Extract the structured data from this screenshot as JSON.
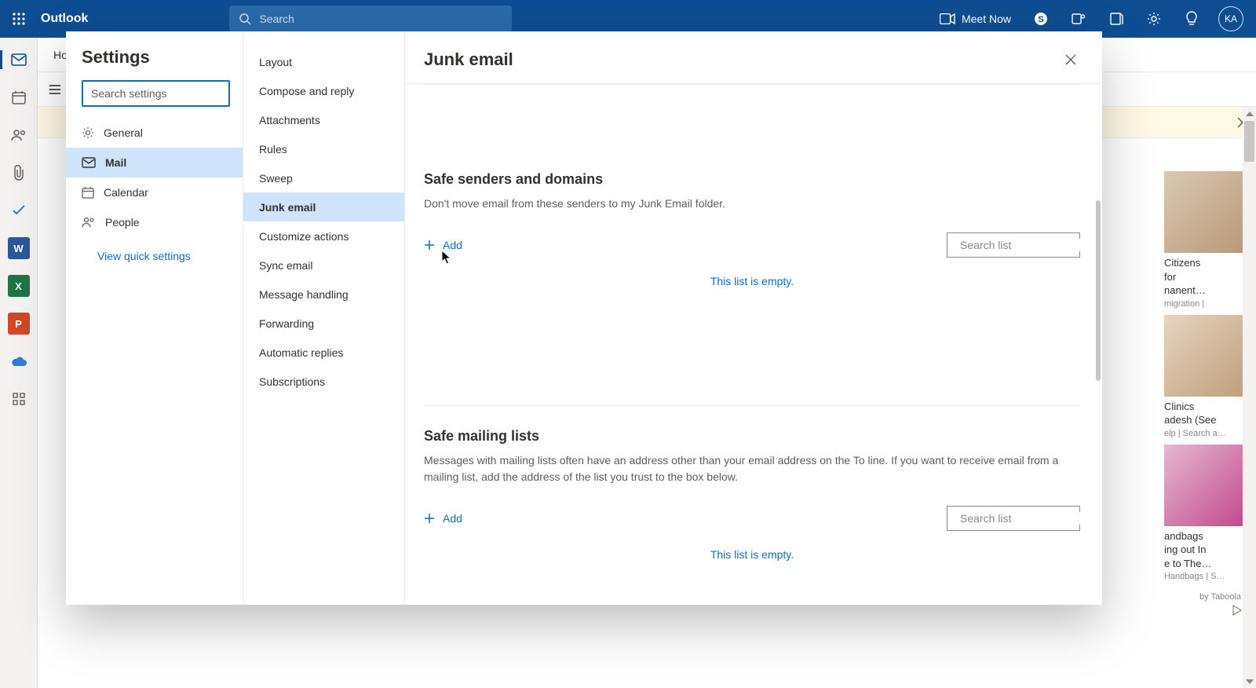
{
  "header": {
    "brand": "Outlook",
    "search_placeholder": "Search",
    "meet_now": "Meet Now",
    "avatar_initials": "KA"
  },
  "behind": {
    "home_label": "Ho"
  },
  "modal": {
    "title": "Settings",
    "search_placeholder": "Search settings",
    "nav1": {
      "general": "General",
      "mail": "Mail",
      "calendar": "Calendar",
      "people": "People"
    },
    "quick_settings": "View quick settings",
    "nav2": {
      "layout": "Layout",
      "compose": "Compose and reply",
      "attachments": "Attachments",
      "rules": "Rules",
      "sweep": "Sweep",
      "junk": "Junk email",
      "customize": "Customize actions",
      "sync": "Sync email",
      "message_handling": "Message handling",
      "forwarding": "Forwarding",
      "automatic_replies": "Automatic replies",
      "subscriptions": "Subscriptions"
    },
    "page": {
      "title": "Junk email",
      "safe_senders": {
        "heading": "Safe senders and domains",
        "desc": "Don't move email from these senders to my Junk Email folder.",
        "add": "Add",
        "search_placeholder": "Search list",
        "empty": "This list is empty."
      },
      "safe_lists": {
        "heading": "Safe mailing lists",
        "desc": "Messages with mailing lists often have an address other than your email address on the To line. If you want to receive email from a mailing list, add the address of the list you trust to the box below.",
        "add": "Add",
        "search_placeholder": "Search list",
        "empty": "This list is empty."
      }
    }
  },
  "ads": {
    "ad1_title": "Citizens",
    "ad1_title2": "for",
    "ad1_title3": "nanent…",
    "ad1_sub": "migration |",
    "ad2_title": "Clinics",
    "ad2_title2": "adesh (See",
    "ad2_sub": "elp | Search a…",
    "ad3_title": "andbags",
    "ad3_title2": "ing out In",
    "ad3_title3": "e to The…",
    "ad3_sub": "Handbags | S…",
    "byline": "by Taboola"
  }
}
